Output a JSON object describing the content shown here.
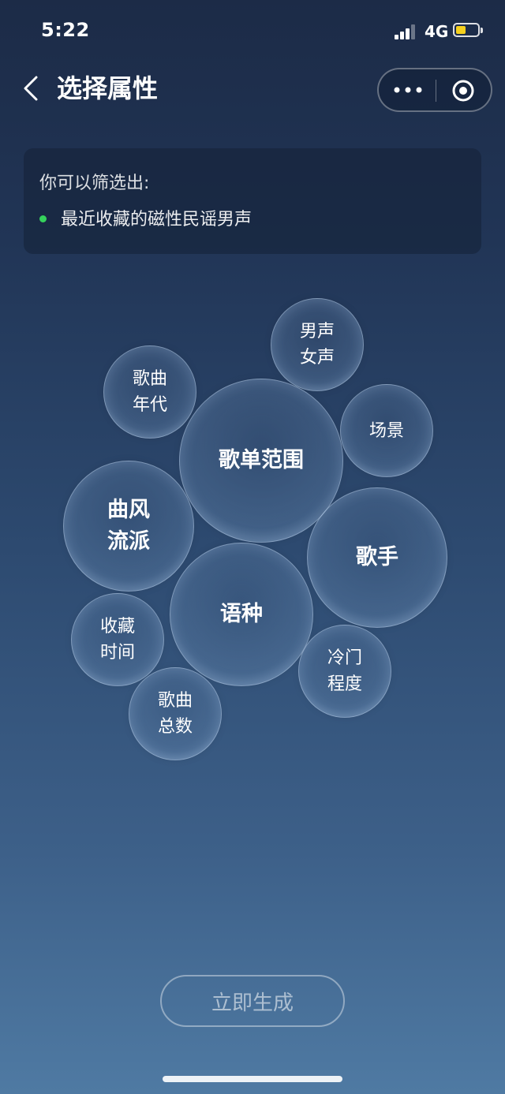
{
  "status_bar": {
    "time": "5:22",
    "network": "4G",
    "icons": [
      "signal-icon",
      "battery-icon"
    ],
    "battery_color": "#f5d01e"
  },
  "nav": {
    "title": "选择属性",
    "icons": [
      "back-icon",
      "more-icon",
      "close-icon"
    ]
  },
  "summary": {
    "heading": "你可以筛选出:",
    "items": [
      "最近收藏的磁性民谣男声"
    ],
    "bullet_color": "#35d25c"
  },
  "bubbles": [
    {
      "lines": [
        "男声",
        "女声"
      ]
    },
    {
      "lines": [
        "歌曲",
        "年代"
      ]
    },
    {
      "lines": [
        "歌单范围"
      ]
    },
    {
      "lines": [
        "场景"
      ]
    },
    {
      "lines": [
        "曲风",
        "流派"
      ]
    },
    {
      "lines": [
        "歌手"
      ]
    },
    {
      "lines": [
        "语种"
      ]
    },
    {
      "lines": [
        "收藏",
        "时间"
      ]
    },
    {
      "lines": [
        "冷门",
        "程度"
      ]
    },
    {
      "lines": [
        "歌曲",
        "总数"
      ]
    }
  ],
  "generate_button": {
    "label": "立即生成"
  }
}
